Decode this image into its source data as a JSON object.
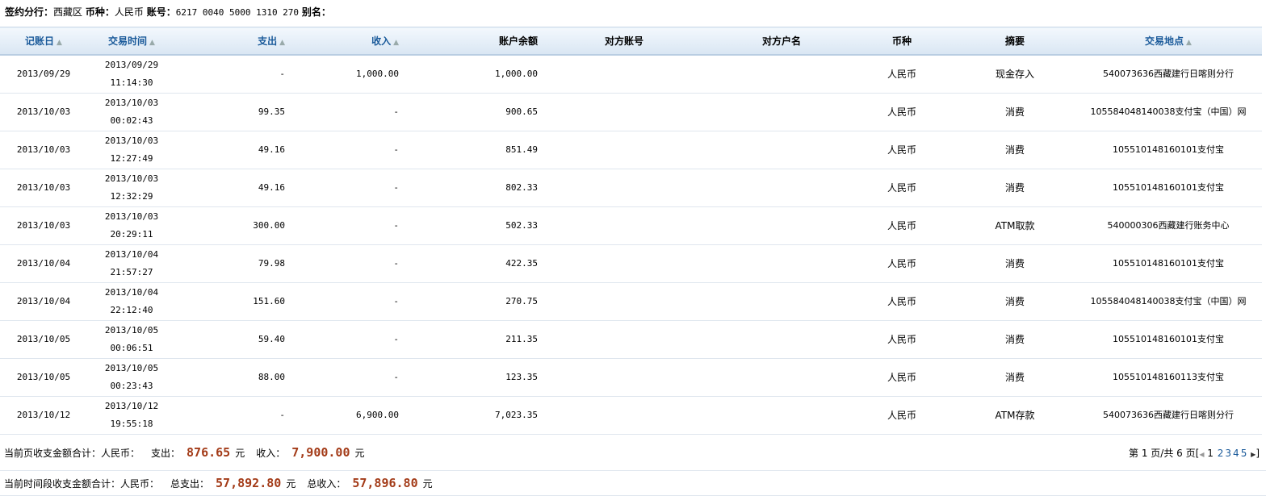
{
  "info": {
    "branch_label": "签约分行：",
    "branch": "西藏区",
    "currency_label": "币种：",
    "currency": "人民币",
    "account_label": "账号：",
    "account": "6217 0040 5000 1310 270",
    "alias_label": "别名："
  },
  "columns": [
    "记账日",
    "交易时间",
    "支出",
    "收入",
    "账户余额",
    "对方账号",
    "对方户名",
    "币种",
    "摘要",
    "交易地点"
  ],
  "rows": [
    {
      "date": "2013/09/29",
      "tdate": "2013/09/29",
      "ttime": "11:14:30",
      "out": "-",
      "in": "1,000.00",
      "bal": "1,000.00",
      "cacct": "",
      "cname": "",
      "cur": "人民币",
      "memo": "现金存入",
      "loc": "540073636西藏建行日喀则分行"
    },
    {
      "date": "2013/10/03",
      "tdate": "2013/10/03",
      "ttime": "00:02:43",
      "out": "99.35",
      "in": "-",
      "bal": "900.65",
      "cacct": "",
      "cname": "",
      "cur": "人民币",
      "memo": "消费",
      "loc": "105584048140038支付宝（中国）网"
    },
    {
      "date": "2013/10/03",
      "tdate": "2013/10/03",
      "ttime": "12:27:49",
      "out": "49.16",
      "in": "-",
      "bal": "851.49",
      "cacct": "",
      "cname": "",
      "cur": "人民币",
      "memo": "消费",
      "loc": "105510148160101支付宝"
    },
    {
      "date": "2013/10/03",
      "tdate": "2013/10/03",
      "ttime": "12:32:29",
      "out": "49.16",
      "in": "-",
      "bal": "802.33",
      "cacct": "",
      "cname": "",
      "cur": "人民币",
      "memo": "消费",
      "loc": "105510148160101支付宝"
    },
    {
      "date": "2013/10/03",
      "tdate": "2013/10/03",
      "ttime": "20:29:11",
      "out": "300.00",
      "in": "-",
      "bal": "502.33",
      "cacct": "",
      "cname": "",
      "cur": "人民币",
      "memo": "ATM取款",
      "loc": "540000306西藏建行账务中心"
    },
    {
      "date": "2013/10/04",
      "tdate": "2013/10/04",
      "ttime": "21:57:27",
      "out": "79.98",
      "in": "-",
      "bal": "422.35",
      "cacct": "",
      "cname": "",
      "cur": "人民币",
      "memo": "消费",
      "loc": "105510148160101支付宝"
    },
    {
      "date": "2013/10/04",
      "tdate": "2013/10/04",
      "ttime": "22:12:40",
      "out": "151.60",
      "in": "-",
      "bal": "270.75",
      "cacct": "",
      "cname": "",
      "cur": "人民币",
      "memo": "消费",
      "loc": "105584048140038支付宝（中国）网"
    },
    {
      "date": "2013/10/05",
      "tdate": "2013/10/05",
      "ttime": "00:06:51",
      "out": "59.40",
      "in": "-",
      "bal": "211.35",
      "cacct": "",
      "cname": "",
      "cur": "人民币",
      "memo": "消费",
      "loc": "105510148160101支付宝"
    },
    {
      "date": "2013/10/05",
      "tdate": "2013/10/05",
      "ttime": "00:23:43",
      "out": "88.00",
      "in": "-",
      "bal": "123.35",
      "cacct": "",
      "cname": "",
      "cur": "人民币",
      "memo": "消费",
      "loc": "105510148160113支付宝"
    },
    {
      "date": "2013/10/12",
      "tdate": "2013/10/12",
      "ttime": "19:55:18",
      "out": "-",
      "in": "6,900.00",
      "bal": "7,023.35",
      "cacct": "",
      "cname": "",
      "cur": "人民币",
      "memo": "ATM存款",
      "loc": "540073636西藏建行日喀则分行"
    }
  ],
  "page_summary": {
    "label": "当前页收支金额合计：人民币：",
    "out_label": "支出：",
    "out": "876.65",
    "in_label": "收入：",
    "in": "7,900.00",
    "unit": "元"
  },
  "period_summary": {
    "label": "当前时间段收支金额合计：人民币：",
    "out_label": "总支出：",
    "out": "57,892.80",
    "in_label": "总收入：",
    "in": "57,896.80",
    "unit": "元"
  },
  "pager": {
    "text": "第 1 页/共 6 页[",
    "pages": [
      "1",
      "2",
      "3",
      "4",
      "5"
    ],
    "close": "]"
  }
}
